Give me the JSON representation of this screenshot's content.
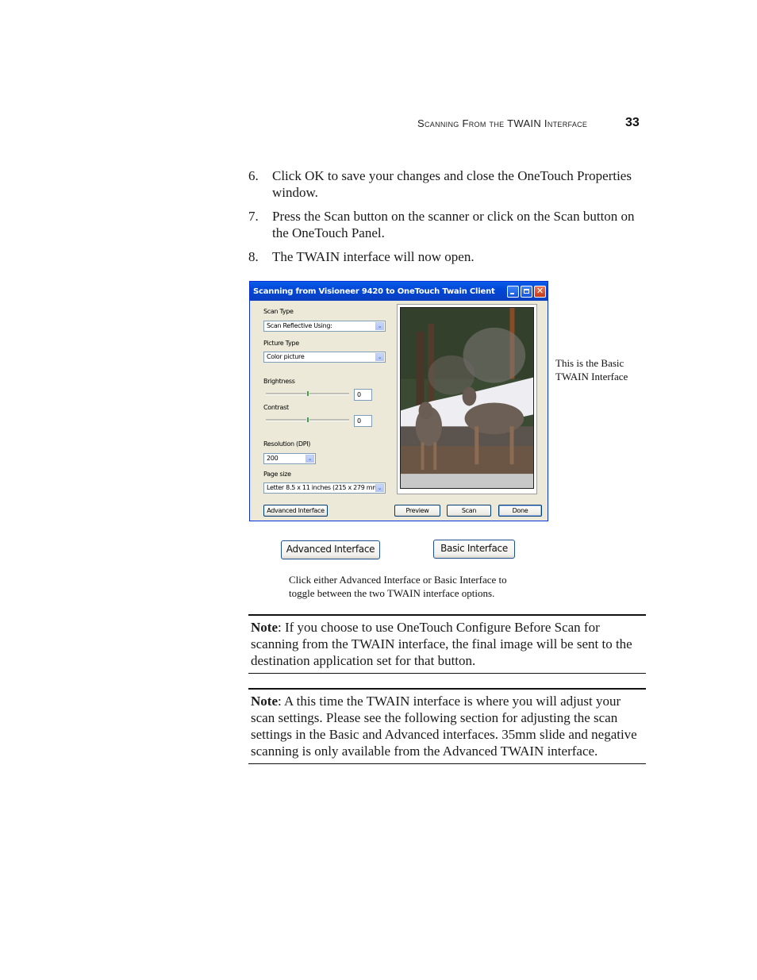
{
  "header": {
    "running_title": "Scanning From the TWAIN Interface",
    "page_number": "33"
  },
  "steps": [
    {
      "number": "6.",
      "text": "Click OK to save your changes and close the OneTouch Properties window."
    },
    {
      "number": "7.",
      "text": "Press the Scan button on the scanner or click on the Scan button on the OneTouch Panel."
    },
    {
      "number": "8.",
      "text": "The TWAIN interface will now open."
    }
  ],
  "dialog": {
    "title": "Scanning from Visioneer 9420 to OneTouch Twain Client",
    "close_glyph": "✕",
    "scan_type": {
      "label": "Scan Type",
      "value": "Scan Reflective Using:"
    },
    "picture_type": {
      "label": "Picture Type",
      "value": "Color picture"
    },
    "brightness": {
      "label": "Brightness",
      "value": "0",
      "slider_fraction": 0.5
    },
    "contrast": {
      "label": "Contrast",
      "value": "0",
      "slider_fraction": 0.5
    },
    "resolution": {
      "label": "Resolution (DPI)",
      "value": "200"
    },
    "page_size": {
      "label": "Page size",
      "value": "Letter 8.5 x 11 inches (215 x 279 mm)"
    },
    "dropdown_glyph": "⌄",
    "buttons": {
      "advanced": "Advanced Interface",
      "preview": "Preview",
      "scan": "Scan",
      "done": "Done"
    },
    "preview_alt": "Preview image of two deer standing near snow in front of pine trees"
  },
  "caption_right": [
    "This is the Basic",
    "TWAIN Interface"
  ],
  "toggle_buttons": {
    "advanced": "Advanced Interface",
    "basic": "Basic Interface"
  },
  "caption_bottom": [
    "Click either Advanced Interface or Basic Interface to",
    "toggle between the two TWAIN interface options."
  ],
  "notes": [
    {
      "label": "Note",
      "text": ": If you choose to use OneTouch Configure Before Scan for scanning from the TWAIN interface, the final image will be sent to the destination application set for that button."
    },
    {
      "label": "Note",
      "text": ": A this time the TWAIN interface is where you will adjust your scan settings. Please see the following section for adjusting the scan settings in the Basic and Advanced interfaces. 35mm slide and negative scanning is only available from the Advanced TWAIN interface."
    }
  ]
}
